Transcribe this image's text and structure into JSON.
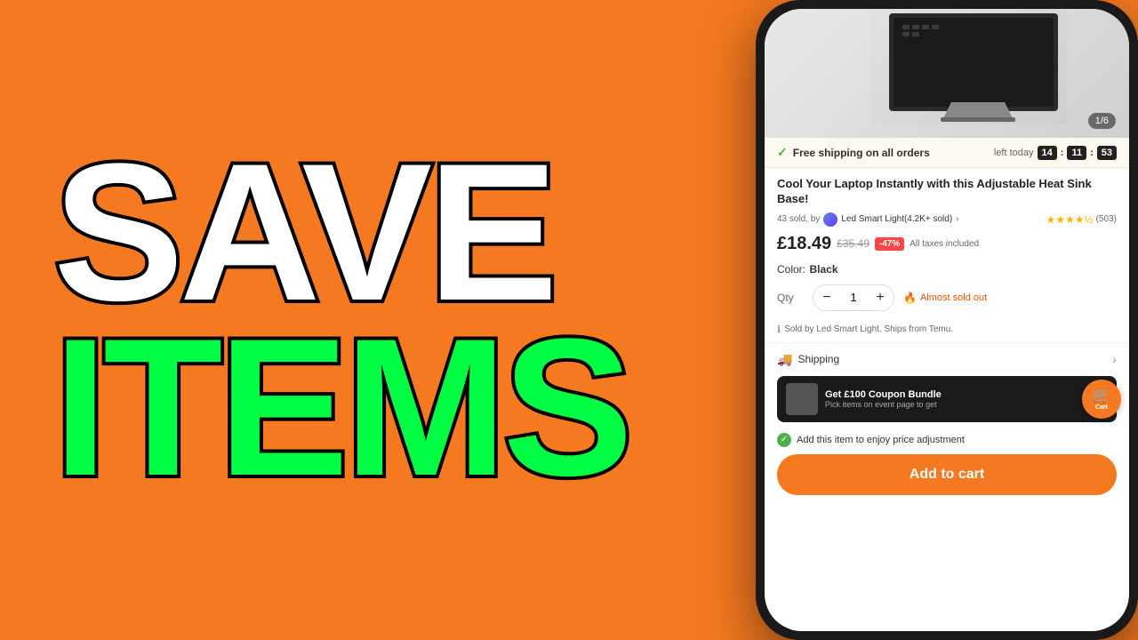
{
  "left": {
    "line1": "SAVE",
    "line2": "ITEMS"
  },
  "phone": {
    "image_counter": "1/6",
    "shipping_banner": {
      "text": "Free shipping on all orders",
      "left_label": "left today",
      "timer": {
        "hours": "14",
        "minutes": "11",
        "seconds": "53"
      }
    },
    "product": {
      "title": "Cool Your Laptop Instantly with this Adjustable Heat Sink Base!",
      "sold_count": "43 sold, by",
      "seller_name": "Led Smart Light(4.2K+ sold)",
      "rating_stars": "★★★★½",
      "review_count": "(503)",
      "current_price": "£18.49",
      "original_price": "£35.49",
      "discount": "-47%",
      "tax_label": "All taxes included",
      "color_label": "Color:",
      "color_value": "Black",
      "qty_label": "Qty",
      "qty_value": "1",
      "almost_sold_out": "Almost sold out",
      "ships_from": "Sold by Led Smart Light. Ships from Temu."
    },
    "shipping_row": {
      "label": "Shipping"
    },
    "coupon": {
      "title": "Get £100 Coupon Bundle",
      "subtitle": "Pick items on event page to get",
      "cart_label": "Cart"
    },
    "price_adjustment": "Add this item to enjoy price adjustment",
    "add_to_cart": "Add to cart",
    "qty_minus": "−",
    "qty_plus": "+"
  }
}
